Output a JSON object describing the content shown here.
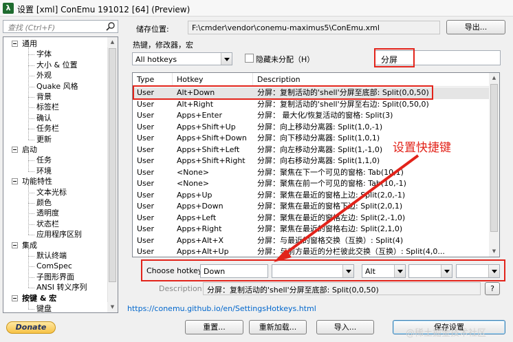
{
  "window": {
    "app_icon": "λ",
    "title": "设置 [xml] ConEmu 191012 [64] (Preview)"
  },
  "sidebar": {
    "search_placeholder": "查找 (Ctrl+F)",
    "tree": [
      {
        "label": "通用",
        "level": 0,
        "toggle": true
      },
      {
        "label": "字体",
        "level": 1
      },
      {
        "label": "大小 & 位置",
        "level": 1
      },
      {
        "label": "外观",
        "level": 1
      },
      {
        "label": "Quake 风格",
        "level": 1
      },
      {
        "label": "背景",
        "level": 1
      },
      {
        "label": "标签栏",
        "level": 1
      },
      {
        "label": "确认",
        "level": 1
      },
      {
        "label": "任务栏",
        "level": 1
      },
      {
        "label": "更新",
        "level": 1
      },
      {
        "label": "启动",
        "level": 0,
        "toggle": true
      },
      {
        "label": "任务",
        "level": 1
      },
      {
        "label": "环境",
        "level": 1
      },
      {
        "label": "功能特性",
        "level": 0,
        "toggle": true
      },
      {
        "label": "文本光标",
        "level": 1
      },
      {
        "label": "颜色",
        "level": 1
      },
      {
        "label": "透明度",
        "level": 1
      },
      {
        "label": "状态栏",
        "level": 1
      },
      {
        "label": "应用程序区别",
        "level": 1
      },
      {
        "label": "集成",
        "level": 0,
        "toggle": true
      },
      {
        "label": "默认终端",
        "level": 1
      },
      {
        "label": "ComSpec",
        "level": 1
      },
      {
        "label": "子图形界面",
        "level": 1
      },
      {
        "label": "ANSI 转义序列",
        "level": 1
      },
      {
        "label": "按键 & 宏",
        "level": 0,
        "toggle": true,
        "bold": true
      },
      {
        "label": "键盘",
        "level": 1
      }
    ]
  },
  "header": {
    "storage_label": "储存位置:",
    "storage_path": "F:\\cmder\\vendor\\conemu-maximus5\\ConEmu.xml",
    "export_button": "导出..."
  },
  "section_title": "热键，修改器，宏",
  "filter": {
    "dropdown_value": "All hotkeys",
    "hide_unassigned_label": "隐藏未分配（H）",
    "hide_unassigned_checked": false,
    "search_value": "分屏"
  },
  "table": {
    "columns": [
      "Type",
      "Hotkey",
      "Description"
    ],
    "rows": [
      {
        "type": "User",
        "hotkey": "Alt+Down",
        "description": "分屏：复制活动的'shell'分屏至底部: Split(0,0,50)",
        "selected": true
      },
      {
        "type": "User",
        "hotkey": "Alt+Right",
        "description": "分屏：复制活动的'shell'分屏至右边: Split(0,50,0)"
      },
      {
        "type": "User",
        "hotkey": "Apps+Enter",
        "description": "分屏： 最大化/恢复活动的窗格: Split(3)"
      },
      {
        "type": "User",
        "hotkey": "Apps+Shift+Up",
        "description": "分屏：向上移动分离器: Split(1,0,-1)"
      },
      {
        "type": "User",
        "hotkey": "Apps+Shift+Down",
        "description": "分屏：向下移动分离器: Split(1,0,1)"
      },
      {
        "type": "User",
        "hotkey": "Apps+Shift+Left",
        "description": "分屏：向左移动分离器: Split(1,-1,0)"
      },
      {
        "type": "User",
        "hotkey": "Apps+Shift+Right",
        "description": "分屏：向右移动分离器: Split(1,1,0)"
      },
      {
        "type": "User",
        "hotkey": "<None>",
        "description": "分屏：聚焦在下一个可见的窗格: Tab(10,1)"
      },
      {
        "type": "User",
        "hotkey": "<None>",
        "description": "分屏：聚焦在前一个可见的窗格: Tab(10,-1)"
      },
      {
        "type": "User",
        "hotkey": "Apps+Up",
        "description": "分屏：聚焦在最近的窗格上边: Split(2,0,-1)"
      },
      {
        "type": "User",
        "hotkey": "Apps+Down",
        "description": "分屏：聚焦在最近的窗格下边: Split(2,0,1)"
      },
      {
        "type": "User",
        "hotkey": "Apps+Left",
        "description": "分屏：聚焦在最近的窗格左边: Split(2,-1,0)"
      },
      {
        "type": "User",
        "hotkey": "Apps+Right",
        "description": "分屏：聚焦在最近的窗格右边: Split(2,1,0)"
      },
      {
        "type": "User",
        "hotkey": "Apps+Alt+X",
        "description": "分屏：与最近的窗格交换（互换）: Split(4)"
      },
      {
        "type": "User",
        "hotkey": "Apps+Alt+Up",
        "description": "分屏：与前方最近的分栏彼此交换（互换）: Split(4,0..."
      }
    ]
  },
  "choose_hotkey": {
    "label": "Choose hotkey:",
    "value": "Down",
    "modifier_1": "",
    "modifier_2": "Alt",
    "modifier_3": "",
    "modifier_4": ""
  },
  "description": {
    "label": "Description:",
    "value": "分屏：复制活动的'shell'分屏至底部: Split(0,0,50)",
    "help_button": "?"
  },
  "annotation_text": "设置快捷键",
  "footer": {
    "link": "https://conemu.github.io/en/SettingsHotkeys.html",
    "donate": "Donate",
    "reset_button": "重置...",
    "reload_button": "重新加载...",
    "import_button": "导入...",
    "save_button": "保存设置",
    "watermark": "@稀土掘金技术社区"
  },
  "colors": {
    "annotation_red": "#e2231a",
    "link_blue": "#0066cc"
  }
}
